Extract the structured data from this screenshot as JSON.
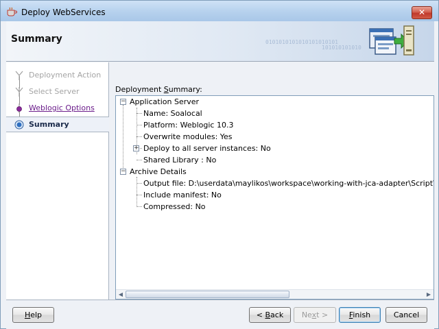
{
  "window": {
    "title": "Deploy WebServices"
  },
  "header": {
    "title": "Summary",
    "decor_binary_1": "0101010101010101010101",
    "decor_binary_2": "101010101010"
  },
  "nav": {
    "items": [
      {
        "label": "Deployment Action",
        "state": "disabled"
      },
      {
        "label": "Select Server",
        "state": "disabled"
      },
      {
        "label": "Weblogic Options",
        "state": "link"
      },
      {
        "label": "Summary",
        "state": "active"
      }
    ]
  },
  "content": {
    "summary_label_prefix": "Deployment ",
    "summary_label_mnemonic": "S",
    "summary_label_suffix": "ummary:",
    "tree": {
      "app_server": "Application Server",
      "name": "Name: Soalocal",
      "platform": "Platform: Weblogic 10.3",
      "overwrite": "Overwrite modules: Yes",
      "deploy_all": "Deploy to all server instances: No",
      "shared_lib": "Shared Library : No",
      "archive": "Archive Details",
      "output_file": "Output file: D:\\userdata\\maylikos\\workspace\\working-with-jca-adapter\\ScriptWrapper",
      "manifest": "Include manifest: No",
      "compressed": "Compressed: No"
    }
  },
  "footer": {
    "help": {
      "prefix": "",
      "mnemonic": "H",
      "suffix": "elp"
    },
    "back": {
      "prefix": "< ",
      "mnemonic": "B",
      "suffix": "ack"
    },
    "next": {
      "prefix": "Ne",
      "mnemonic": "x",
      "suffix": "t >"
    },
    "finish": {
      "prefix": "",
      "mnemonic": "F",
      "suffix": "inish"
    },
    "cancel": "Cancel"
  }
}
